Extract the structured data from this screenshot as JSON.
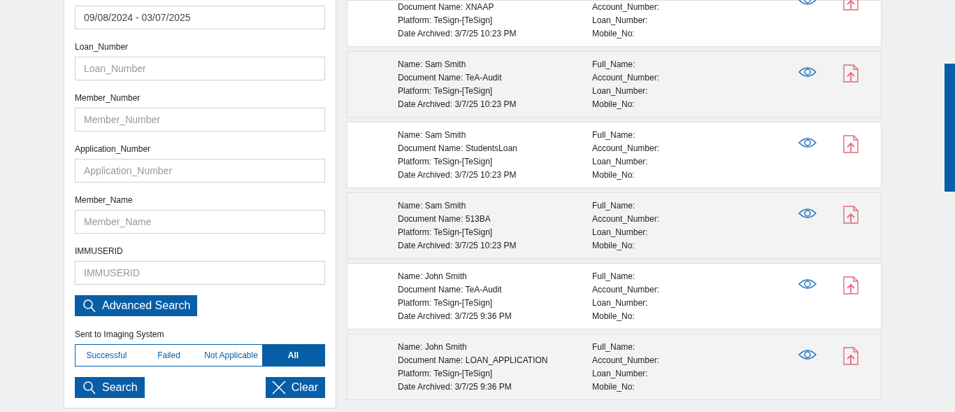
{
  "filters": {
    "date_range": {
      "value": "09/08/2024 - 03/07/2025"
    },
    "fields": [
      {
        "label": "Loan_Number",
        "placeholder": "Loan_Number"
      },
      {
        "label": "Member_Number",
        "placeholder": "Member_Number"
      },
      {
        "label": "Application_Number",
        "placeholder": "Application_Number"
      },
      {
        "label": "Member_Name",
        "placeholder": "Member_Name"
      },
      {
        "label": "IMMUSERID",
        "placeholder": "IMMUSERID"
      }
    ],
    "advanced_search_button": "Advanced Search",
    "imaging_status": {
      "label": "Sent to Imaging System",
      "options": [
        {
          "label": "Successful",
          "selected": false
        },
        {
          "label": "Failed",
          "selected": false
        },
        {
          "label": "Not Applicable",
          "selected": false
        },
        {
          "label": "All",
          "selected": true
        }
      ]
    },
    "search_button": "Search",
    "clear_button": "Clear"
  },
  "results": [
    {
      "left": [
        "Document Name: XNAAP",
        "Platform: TeSign-[TeSign]",
        "Date Archived: 3/7/25 10:23 PM"
      ],
      "right": [
        "Account_Number:",
        "Loan_Number:",
        "Mobile_No:"
      ]
    },
    {
      "left": [
        "Name: Sam Smith",
        "Document Name: TeA-Audit",
        "Platform: TeSign-[TeSign]",
        "Date Archived: 3/7/25 10:23 PM"
      ],
      "right": [
        "Full_Name:",
        "Account_Number:",
        "Loan_Number:",
        "Mobile_No:"
      ]
    },
    {
      "left": [
        "Name: Sam Smith",
        "Document Name: StudentsLoan",
        "Platform: TeSign-[TeSign]",
        "Date Archived: 3/7/25 10:23 PM"
      ],
      "right": [
        "Full_Name:",
        "Account_Number:",
        "Loan_Number:",
        "Mobile_No:"
      ]
    },
    {
      "left": [
        "Name: Sam Smith",
        "Document Name: 513BA",
        "Platform: TeSign-[TeSign]",
        "Date Archived: 3/7/25 10:23 PM"
      ],
      "right": [
        "Full_Name:",
        "Account_Number:",
        "Loan_Number:",
        "Mobile_No:"
      ]
    },
    {
      "left": [
        "Name: John Smith",
        "Document Name: TeA-Audit",
        "Platform: TeSign-[TeSign]",
        "Date Archived: 3/7/25 9:36 PM"
      ],
      "right": [
        "Full_Name:",
        "Account_Number:",
        "Loan_Number:",
        "Mobile_No:"
      ]
    },
    {
      "left": [
        "Name: John Smith",
        "Document Name: LOAN_APPLICATION",
        "Platform: TeSign-[TeSign]",
        "Date Archived: 3/7/25 9:36 PM"
      ],
      "right": [
        "Full_Name:",
        "Account_Number:",
        "Loan_Number:",
        "Mobile_No:"
      ]
    }
  ]
}
